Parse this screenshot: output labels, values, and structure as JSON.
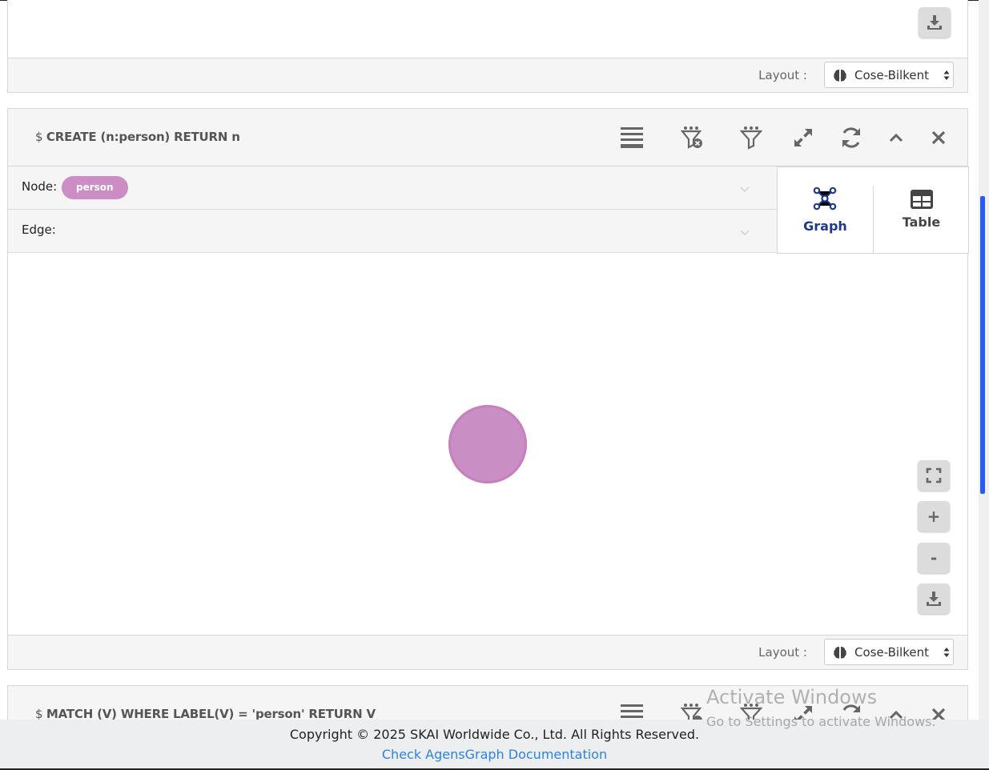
{
  "top_card": {
    "layout_label": "Layout :",
    "layout_value": "Cose-Bilkent"
  },
  "main_card": {
    "query_prefix": "$",
    "query_text": "CREATE (n:person) RETURN n",
    "toolbar_icons": [
      "list-icon",
      "filter-clear-icon",
      "filter-icon",
      "expand-icon",
      "refresh-icon",
      "collapse-icon",
      "close-icon"
    ],
    "node_label": "Node:",
    "node_pill": "person",
    "edge_label": "Edge:",
    "view_graph": "Graph",
    "view_table": "Table",
    "zoom_in": "+",
    "zoom_out": "-",
    "layout_label": "Layout :",
    "layout_value": "Cose-Bilkent",
    "node_color": "#c98fc4"
  },
  "next_card": {
    "query_prefix": "$",
    "query_text": "MATCH (V) WHERE LABEL(V) = 'person' RETURN V"
  },
  "footer": {
    "copyright": "Copyright © 2025 SKAI Worldwide Co., Ltd. All Rights Reserved.",
    "doc_link": "Check AgensGraph Documentation"
  },
  "watermark": {
    "title": "Activate Windows",
    "subtitle": "Go to Settings to activate Windows."
  },
  "colors": {
    "accent": "#2c59f5",
    "graph_active": "#1f3a8a",
    "link": "#2b83e6"
  }
}
